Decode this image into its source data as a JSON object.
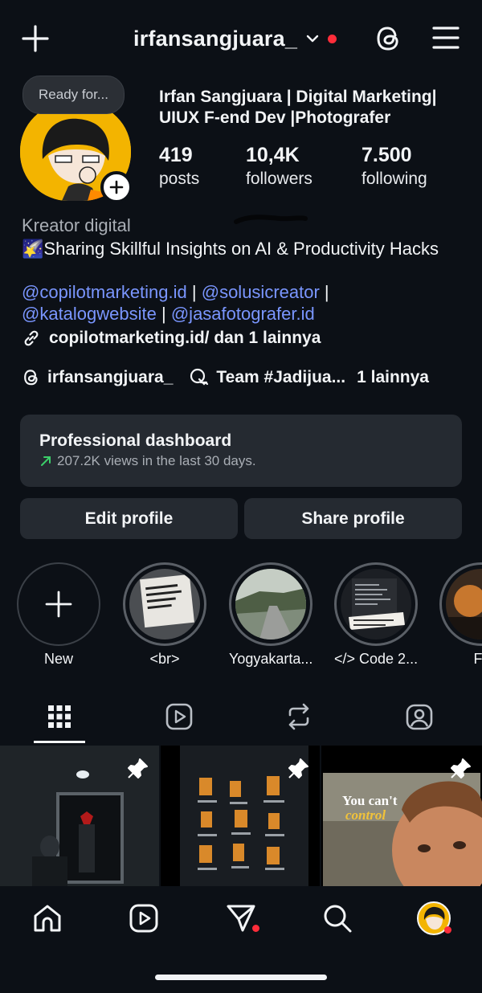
{
  "header": {
    "username": "irfansangjuara_",
    "icons": [
      "plus-icon",
      "chevron-down-icon",
      "notification-dot",
      "threads-icon",
      "menu-icon"
    ]
  },
  "profile": {
    "note": "Ready for...",
    "full_name": "Irfan Sangjuara | Digital Marketing| UIUX F-end Dev |Photografer",
    "stats": [
      {
        "value": "419",
        "label": "posts"
      },
      {
        "value": "10,4K",
        "label": "followers"
      },
      {
        "value": "7.500",
        "label": "following"
      }
    ]
  },
  "bio": {
    "category": "Kreator digital",
    "emoji": "🌠",
    "text": "Sharing Skillful Insights on AI & Productivity Hacks",
    "mentions": [
      "@copilotmarketing.id",
      "@solusicreator",
      "@katalogwebsite",
      "@jasafotografer.id"
    ],
    "separator": "|",
    "link": "copilotmarketing.id/ dan 1 lainnya",
    "threads_handle": "irfansangjuara_",
    "channel": "Team #Jadijua...",
    "more": "1 lainnya"
  },
  "dashboard": {
    "title": "Professional dashboard",
    "subtitle": "207.2K views in the last 30 days.",
    "trend_color": "#3ccf6a"
  },
  "buttons": {
    "edit": "Edit profile",
    "share": "Share profile"
  },
  "highlights": [
    {
      "label": "New"
    },
    {
      "label": "<br>"
    },
    {
      "label": "Yogyakarta..."
    },
    {
      "label": "</> Code 2..."
    },
    {
      "label": "Fil"
    }
  ],
  "tabs": [
    "grid-icon",
    "reels-icon",
    "reposts-icon",
    "tagged-icon"
  ],
  "grid_posts": [
    {
      "caption": "",
      "pinned": true
    },
    {
      "caption": "",
      "pinned": true
    },
    {
      "caption": "You can't control",
      "pinned": true
    }
  ],
  "bottom_nav": [
    "home-icon",
    "reels-icon",
    "messages-icon",
    "search-icon",
    "profile-avatar"
  ],
  "colors": {
    "background": "#0c1016",
    "card": "#252a31",
    "mention": "#7a96ff",
    "notification": "#ff2d3a"
  }
}
